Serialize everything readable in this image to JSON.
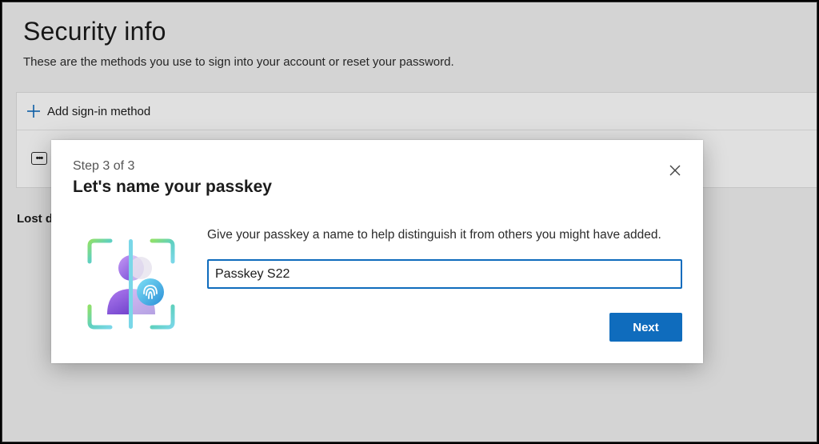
{
  "page": {
    "title": "Security info",
    "subtitle": "These are the methods you use to sign into your account or reset your password.",
    "add_method_label": "Add sign-in method",
    "lost_device_label": "Lost d"
  },
  "dialog": {
    "step": "Step 3 of 3",
    "title": "Let's name your passkey",
    "prompt": "Give your passkey a name to help distinguish it from others you might have added.",
    "input_value": "Passkey S22",
    "next_label": "Next"
  },
  "colors": {
    "accent": "#0f6cbd",
    "page_background": "#f2f2f2",
    "dialog_background": "#ffffff"
  },
  "icons": {
    "add": "plus-icon",
    "method": "more-dots-icon",
    "close": "close-icon",
    "illustration": "passkey-fingerprint-illustration"
  }
}
